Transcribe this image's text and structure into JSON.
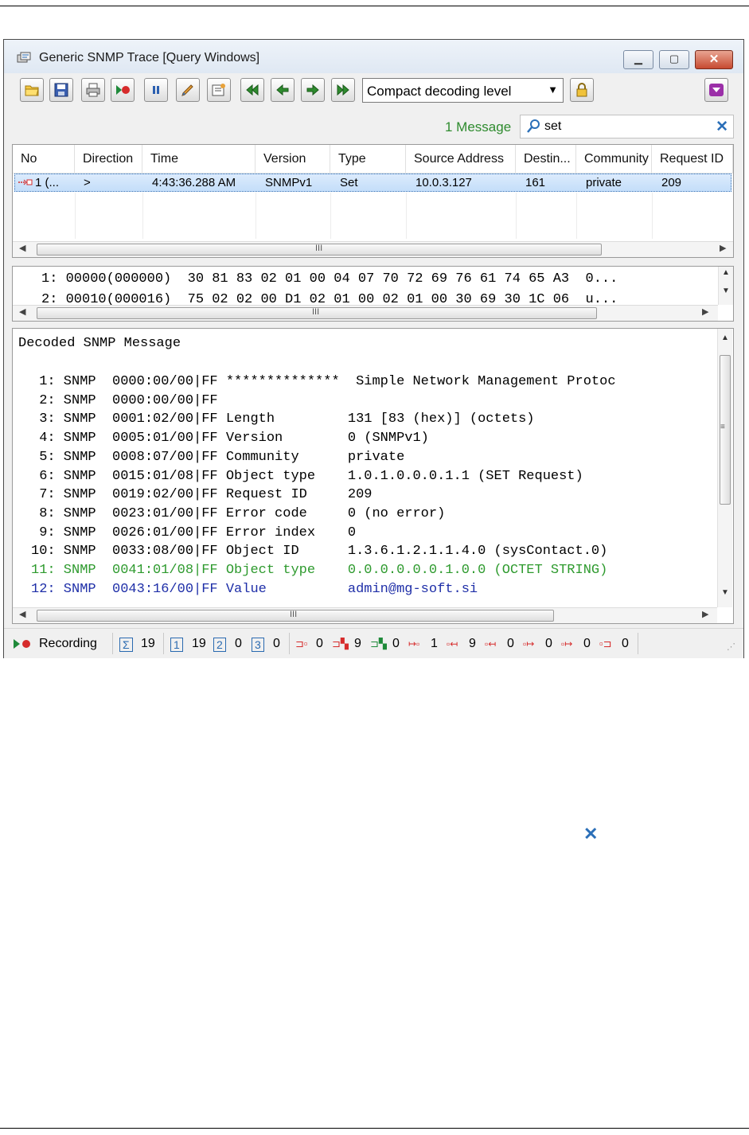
{
  "window": {
    "title": "Generic SNMP Trace [Query Windows]",
    "controls": {
      "minimize": "▁",
      "maximize": "▢",
      "close": "✕"
    }
  },
  "toolbar": {
    "buttons": [
      "open-icon",
      "save-icon",
      "print-icon",
      "record-icon",
      "pause-icon",
      "edit-icon",
      "properties-icon",
      "first-icon",
      "prev-icon",
      "next-icon",
      "last-icon"
    ],
    "decoding_level": "Compact decoding level",
    "lock_icon": "lock-icon",
    "right_icon": "filter-icon"
  },
  "filter": {
    "message_count": "1 Message",
    "search_value": "set",
    "clear_icon": "✕"
  },
  "grid": {
    "columns": [
      "No",
      "Direction",
      "Time",
      "Version",
      "Type",
      "Source Address",
      "Destin...",
      "Community",
      "Request ID"
    ],
    "rows": [
      {
        "no": "1 (...",
        "direction": ">",
        "time": "4:43:36.288 AM",
        "version": "SNMPv1",
        "type": "Set",
        "source": "10.0.3.127",
        "dest": "161",
        "community": "private",
        "request_id": "209"
      }
    ]
  },
  "hex": {
    "lines": [
      "1: 00000(000000)  30 81 83 02 01 00 04 07 70 72 69 76 61 74 65 A3  0...",
      "2: 00010(000016)  75 02 02 00 D1 02 01 00 02 01 00 30 69 30 1C 06  u..."
    ]
  },
  "decoded": {
    "title": "Decoded SNMP Message",
    "lines": [
      {
        "text": " 1: SNMP  0000:00/00|FF **************  Simple Network Management Protoc",
        "style": "normal"
      },
      {
        "text": " 2: SNMP  0000:00/00|FF",
        "style": "normal"
      },
      {
        "text": " 3: SNMP  0001:02/00|FF Length         131 [83 (hex)] (octets)",
        "style": "normal"
      },
      {
        "text": " 4: SNMP  0005:01/00|FF Version        0 (SNMPv1)",
        "style": "normal"
      },
      {
        "text": " 5: SNMP  0008:07/00|FF Community      private",
        "style": "normal"
      },
      {
        "text": " 6: SNMP  0015:01/08|FF Object type    1.0.1.0.0.0.1.1 (SET Request)",
        "style": "normal"
      },
      {
        "text": " 7: SNMP  0019:02/00|FF Request ID     209",
        "style": "normal"
      },
      {
        "text": " 8: SNMP  0023:01/00|FF Error code     0 (no error)",
        "style": "normal"
      },
      {
        "text": " 9: SNMP  0026:01/00|FF Error index    0",
        "style": "normal"
      },
      {
        "text": "10: SNMP  0033:08/00|FF Object ID      1.3.6.1.2.1.1.4.0 (sysContact.0)",
        "style": "normal"
      },
      {
        "text": "11: SNMP  0041:01/08|FF Object type    0.0.0.0.0.0.1.0.0 (OCTET STRING)",
        "style": "green"
      },
      {
        "text": "12: SNMP  0043:16/00|FF Value          admin@mg-soft.si",
        "style": "blue"
      }
    ],
    "colors": {
      "normal": "#000000",
      "green": "#2e9a2e",
      "blue": "#1f2fa8"
    }
  },
  "status": {
    "recording": "Recording",
    "total": "19",
    "v1": "19",
    "v2": "0",
    "v3": "0",
    "counts": [
      "0",
      "9",
      "0",
      "1",
      "9",
      "0",
      "0",
      "0",
      "0"
    ],
    "badges": {
      "sigma": "Σ",
      "one": "1",
      "two": "2",
      "three": "3"
    }
  },
  "floating_close": "✕"
}
